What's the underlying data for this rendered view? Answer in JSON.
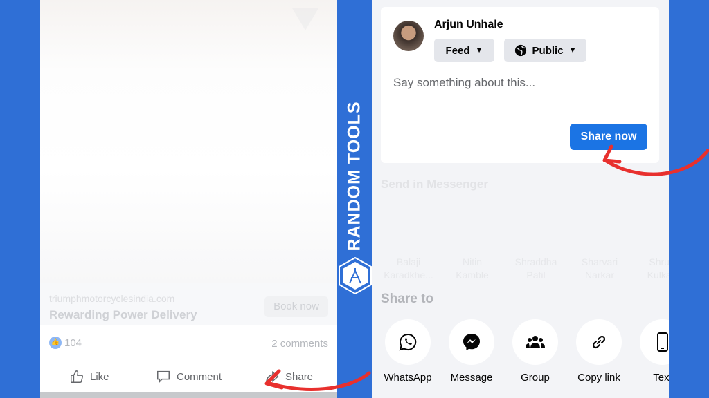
{
  "post": {
    "domain": "triumphmotorcyclesindia.com",
    "headline": "Rewarding Power Delivery",
    "cta": "Book now",
    "like_count": "104",
    "comments": "2 comments",
    "actions": {
      "like": "Like",
      "comment": "Comment",
      "share": "Share"
    }
  },
  "branding": {
    "text": "RANDOM TOOLS"
  },
  "share_dialog": {
    "user_name": "Arjun Unhale",
    "audience_feed": "Feed",
    "audience_privacy": "Public",
    "placeholder": "Say something about this...",
    "share_now": "Share now",
    "messenger_title": "Send in Messenger",
    "contacts": [
      {
        "first": "Balaji",
        "last": "Karadkhe..."
      },
      {
        "first": "Nitin",
        "last": "Kamble"
      },
      {
        "first": "Shraddha",
        "last": "Patil"
      },
      {
        "first": "Sharvari",
        "last": "Narkar"
      },
      {
        "first": "Shru...",
        "last": "Kulka..."
      }
    ],
    "share_to_title": "Share to",
    "options": [
      {
        "label": "WhatsApp",
        "icon": "whatsapp-icon"
      },
      {
        "label": "Message",
        "icon": "messenger-icon"
      },
      {
        "label": "Group",
        "icon": "group-icon"
      },
      {
        "label": "Copy link",
        "icon": "link-icon"
      },
      {
        "label": "Text",
        "icon": "phone-icon"
      }
    ]
  },
  "colors": {
    "background": "#2f6fd6",
    "primary": "#1b74e4",
    "arrow": "#e8302e"
  }
}
